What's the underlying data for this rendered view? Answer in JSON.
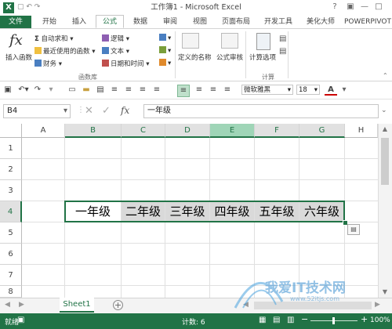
{
  "window": {
    "title": "工作簿1 - Microsoft Excel",
    "app_icon": "X",
    "help": "?"
  },
  "tabs": [
    {
      "label": "文件"
    },
    {
      "label": "开始"
    },
    {
      "label": "插入"
    },
    {
      "label": "公式"
    },
    {
      "label": "数据"
    },
    {
      "label": "审阅"
    },
    {
      "label": "视图"
    },
    {
      "label": "页面布局"
    },
    {
      "label": "开发工具"
    },
    {
      "label": "美化大师"
    },
    {
      "label": "POWERPIVOT"
    }
  ],
  "ribbon": {
    "insert_function": "插入函数",
    "autosum": "自动求和",
    "recent": "最近使用的函数",
    "financial": "财务",
    "logical": "逻辑",
    "text": "文本",
    "datetime": "日期和时间",
    "defined_names": "定义的名称",
    "formula_audit": "公式审核",
    "calc_options": "计算选项",
    "group_library": "函数库",
    "group_calc": "计算"
  },
  "toolbar": {
    "font_name": "微软雅黑",
    "font_size": "18"
  },
  "formula_bar": {
    "name_box": "B4",
    "fx": "fx",
    "content": "一年级"
  },
  "columns": [
    "A",
    "B",
    "C",
    "D",
    "E",
    "F",
    "G",
    "H"
  ],
  "rows": [
    "1",
    "2",
    "3",
    "4",
    "5",
    "6",
    "7",
    "8"
  ],
  "cells_row4": [
    "一年级",
    "二年级",
    "三年级",
    "四年级",
    "五年级",
    "六年级"
  ],
  "sheet": {
    "tab": "Sheet1"
  },
  "status": {
    "ready": "就绪",
    "count": "计数: 6",
    "zoom": "100%"
  },
  "watermark": {
    "text": "我爱IT技术网",
    "url": "www.52itjs.com"
  }
}
